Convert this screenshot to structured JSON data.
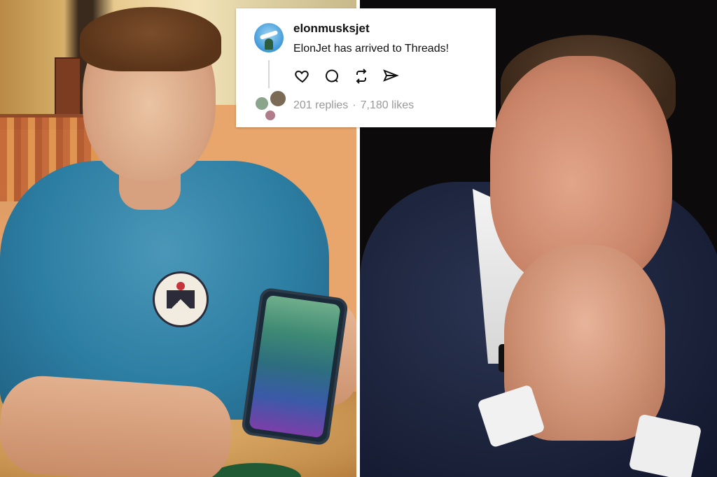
{
  "post": {
    "username": "elonmusksjet",
    "text": "ElonJet has arrived to Threads!",
    "replies": "201 replies",
    "separator": "·",
    "likes": "7,180 likes",
    "actions": [
      {
        "name": "like",
        "icon": "heart-icon"
      },
      {
        "name": "reply",
        "icon": "comment-icon"
      },
      {
        "name": "repost",
        "icon": "repost-icon"
      },
      {
        "name": "share",
        "icon": "send-icon"
      }
    ]
  },
  "colors": {
    "card_bg": "#ffffff",
    "text_primary": "#111111",
    "text_muted": "#999999",
    "left_shirt": "#2d7ea3",
    "right_bg": "#0c0a0a",
    "right_suit": "#1b223a"
  }
}
